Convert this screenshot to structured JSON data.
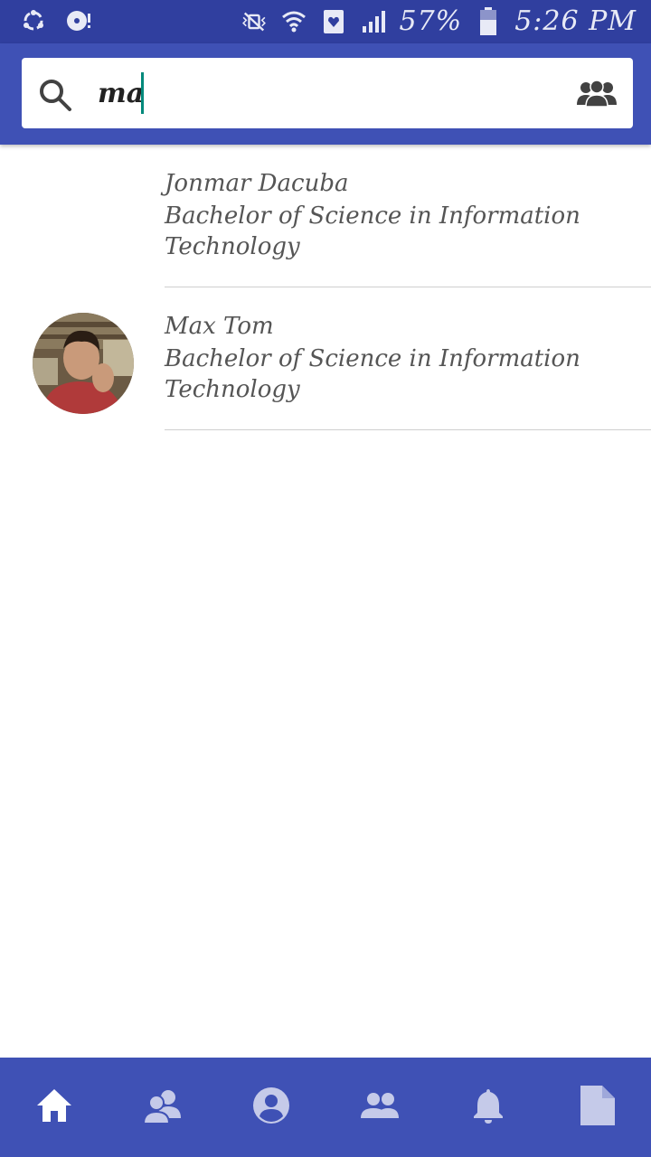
{
  "status_bar": {
    "battery_percent": "57%",
    "time": "5:26 PM"
  },
  "search": {
    "value": "ma",
    "placeholder": ""
  },
  "results": [
    {
      "name": "Jonmar Dacuba",
      "course": "Bachelor of Science in Information Technology",
      "has_avatar": false
    },
    {
      "name": "Max Tom",
      "course": "Bachelor of Science in Information Technology",
      "has_avatar": true
    }
  ],
  "bottom_nav": {
    "items": [
      {
        "icon": "home-icon",
        "active": true
      },
      {
        "icon": "friends-icon",
        "active": false
      },
      {
        "icon": "profile-icon",
        "active": false
      },
      {
        "icon": "groups-icon",
        "active": false
      },
      {
        "icon": "notifications-icon",
        "active": false
      },
      {
        "icon": "document-icon",
        "active": false
      }
    ]
  },
  "colors": {
    "status_bar": "#303f9f",
    "primary": "#3f51b5",
    "caret": "#00897b",
    "nav_inactive": "#c5cae9",
    "nav_active": "#ffffff"
  }
}
